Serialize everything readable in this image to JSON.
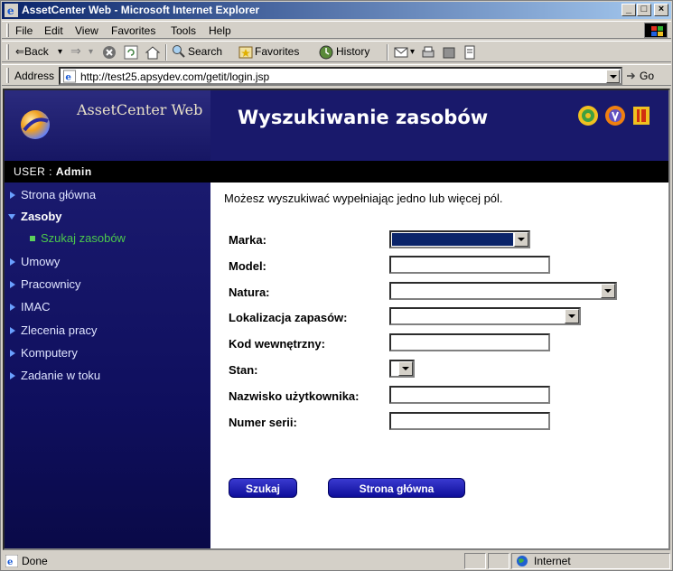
{
  "window": {
    "title": "AssetCenter Web - Microsoft Internet Explorer",
    "controls": [
      "_",
      "□",
      "×"
    ]
  },
  "menubar": {
    "items": [
      "File",
      "Edit",
      "View",
      "Favorites",
      "Tools",
      "Help"
    ]
  },
  "toolbar": {
    "back": "⇐Back",
    "search": "Search",
    "favorites": "Favorites",
    "history": "History"
  },
  "addressbar": {
    "label": "Address",
    "url": "http://test25.apsydev.com/getit/login.jsp",
    "go": "Go"
  },
  "header": {
    "brand": "AssetCenter Web",
    "title": "Wyszukiwanie zasobów"
  },
  "userbar": {
    "prefix": "USER : ",
    "user": "Admin"
  },
  "sidebar": {
    "items": [
      {
        "label": "Strona główna"
      },
      {
        "label": "Zasoby"
      },
      {
        "label": "Szukaj zasobów"
      },
      {
        "label": "Umowy"
      },
      {
        "label": "Pracownicy"
      },
      {
        "label": "IMAC"
      },
      {
        "label": "Zlecenia pracy"
      },
      {
        "label": "Komputery"
      },
      {
        "label": "Zadanie w toku"
      }
    ]
  },
  "form": {
    "intro": "Możesz wyszukiwać wypełniając jedno lub więcej pól.",
    "fields": [
      {
        "label": "Marka:"
      },
      {
        "label": "Model:"
      },
      {
        "label": "Natura:"
      },
      {
        "label": "Lokalizacja zapasów:"
      },
      {
        "label": "Kod wewnętrzny:"
      },
      {
        "label": "Stan:"
      },
      {
        "label": "Nazwisko użytkownika:"
      },
      {
        "label": "Numer serii:"
      }
    ],
    "search_button": "Szukaj",
    "home_button": "Strona główna"
  },
  "statusbar": {
    "status": "Done",
    "zone": "Internet"
  },
  "colors": {
    "header_bg": "#19196b",
    "sidebar_bg": "#1a1a6e",
    "active_sub": "#4cc84c",
    "button_bg": "#0e0e9a"
  }
}
